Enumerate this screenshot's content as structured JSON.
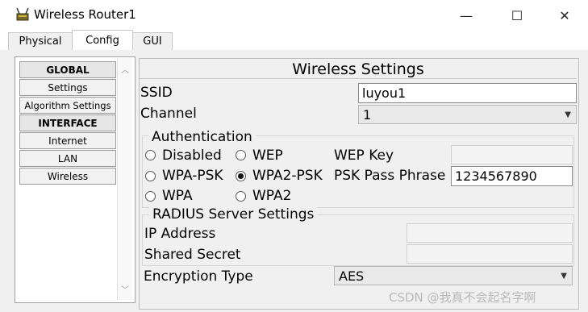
{
  "window": {
    "title": "Wireless Router1",
    "minimize": "—",
    "maximize": "☐",
    "close": "✕"
  },
  "tabs": [
    {
      "label": "Physical"
    },
    {
      "label": "Config"
    },
    {
      "label": "GUI"
    }
  ],
  "sidebar": {
    "items": [
      {
        "label": "GLOBAL",
        "type": "header"
      },
      {
        "label": "Settings",
        "type": "item"
      },
      {
        "label": "Algorithm Settings",
        "type": "item"
      },
      {
        "label": "INTERFACE",
        "type": "header"
      },
      {
        "label": "Internet",
        "type": "item"
      },
      {
        "label": "LAN",
        "type": "item"
      },
      {
        "label": "Wireless",
        "type": "item"
      }
    ]
  },
  "wireless": {
    "heading": "Wireless Settings",
    "ssid_label": "SSID",
    "ssid_value": "luyou1",
    "channel_label": "Channel",
    "channel_value": "1",
    "auth_legend": "Authentication",
    "auth_options": {
      "disabled": "Disabled",
      "wep": "WEP",
      "wpa_psk": "WPA-PSK",
      "wpa2_psk": "WPA2-PSK",
      "wpa": "WPA",
      "wpa2": "WPA2"
    },
    "selected_auth": "WPA2-PSK",
    "wep_key_label": "WEP Key",
    "wep_key_value": "",
    "psk_label": "PSK Pass Phrase",
    "psk_value": "1234567890",
    "radius_legend": "RADIUS Server Settings",
    "ip_label": "IP Address",
    "ip_value": "",
    "secret_label": "Shared Secret",
    "secret_value": "",
    "encryption_label": "Encryption Type",
    "encryption_value": "AES"
  },
  "watermark": "CSDN @我真不会起名字啊"
}
